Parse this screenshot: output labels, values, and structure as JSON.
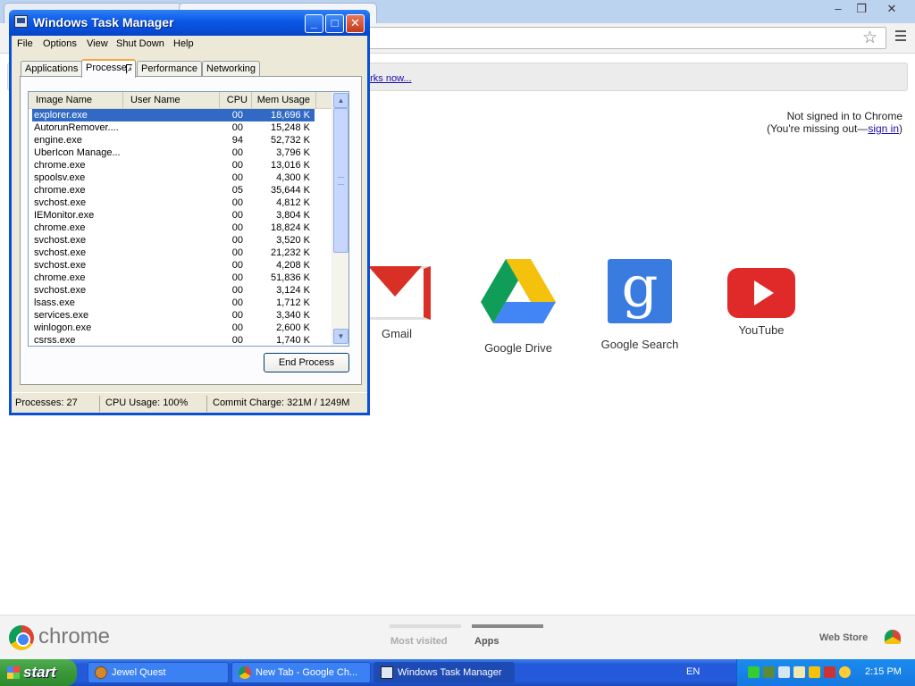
{
  "taskmanager": {
    "title": "Windows Task Manager",
    "menu": [
      "File",
      "Options",
      "View",
      "Shut Down",
      "Help"
    ],
    "tabs": [
      "Applications",
      "Processes",
      "Performance",
      "Networking"
    ],
    "columns": {
      "name": "Image Name",
      "user": "User Name",
      "cpu": "CPU",
      "mem": "Mem Usage"
    },
    "processes": [
      {
        "name": "explorer.exe",
        "user": "",
        "cpu": "00",
        "mem": "18,696 K",
        "selected": true
      },
      {
        "name": "AutorunRemover....",
        "user": "",
        "cpu": "00",
        "mem": "15,248 K"
      },
      {
        "name": "engine.exe",
        "user": "",
        "cpu": "94",
        "mem": "52,732 K"
      },
      {
        "name": "UberIcon Manage...",
        "user": "",
        "cpu": "00",
        "mem": "3,796 K"
      },
      {
        "name": "chrome.exe",
        "user": "",
        "cpu": "00",
        "mem": "13,016 K"
      },
      {
        "name": "spoolsv.exe",
        "user": "",
        "cpu": "00",
        "mem": "4,300 K"
      },
      {
        "name": "chrome.exe",
        "user": "",
        "cpu": "05",
        "mem": "35,644 K"
      },
      {
        "name": "svchost.exe",
        "user": "",
        "cpu": "00",
        "mem": "4,812 K"
      },
      {
        "name": "IEMonitor.exe",
        "user": "",
        "cpu": "00",
        "mem": "3,804 K"
      },
      {
        "name": "chrome.exe",
        "user": "",
        "cpu": "00",
        "mem": "18,824 K"
      },
      {
        "name": "svchost.exe",
        "user": "",
        "cpu": "00",
        "mem": "3,520 K"
      },
      {
        "name": "svchost.exe",
        "user": "",
        "cpu": "00",
        "mem": "21,232 K"
      },
      {
        "name": "svchost.exe",
        "user": "",
        "cpu": "00",
        "mem": "4,208 K"
      },
      {
        "name": "chrome.exe",
        "user": "",
        "cpu": "00",
        "mem": "51,836 K"
      },
      {
        "name": "svchost.exe",
        "user": "",
        "cpu": "00",
        "mem": "3,124 K"
      },
      {
        "name": "lsass.exe",
        "user": "",
        "cpu": "00",
        "mem": "1,712 K"
      },
      {
        "name": "services.exe",
        "user": "",
        "cpu": "00",
        "mem": "3,340 K"
      },
      {
        "name": "winlogon.exe",
        "user": "",
        "cpu": "00",
        "mem": "2,600 K"
      },
      {
        "name": "csrss.exe",
        "user": "",
        "cpu": "00",
        "mem": "1,740 K"
      }
    ],
    "end_process_label": "End Process",
    "status": {
      "processes": "Processes: 27",
      "cpu": "CPU Usage: 100%",
      "commit": "Commit Charge: 321M / 1249M"
    }
  },
  "chrome": {
    "bookmark_link": "arks now...",
    "signin_line1": "Not signed in to Chrome",
    "signin_line2_prefix": "(You're missing out—",
    "signin_link": "sign in",
    "signin_line2_suffix": ")",
    "apps": [
      {
        "label": "Gmail",
        "icon": "gmail-icon"
      },
      {
        "label": "Google Drive",
        "icon": "google-drive-icon"
      },
      {
        "label": "Google Search",
        "icon": "google-search-icon"
      },
      {
        "label": "YouTube",
        "icon": "youtube-icon"
      }
    ],
    "search_glyph": "g",
    "wordmark": "chrome",
    "ntp_tabs": {
      "most_visited": "Most visited",
      "apps": "Apps"
    },
    "web_store": "Web Store"
  },
  "taskbar": {
    "start_label": "start",
    "tasks": [
      {
        "label": "Jewel Quest",
        "active": false
      },
      {
        "label": "New Tab - Google Ch...",
        "active": false
      },
      {
        "label": "Windows Task Manager",
        "active": true
      }
    ],
    "language": "EN",
    "clock": "2:15 PM"
  },
  "colors": {
    "xp_title_blue": "#0a58e6",
    "selection_blue": "#316ac5",
    "start_green": "#3a983a",
    "taskbar_blue": "#245bdb"
  }
}
